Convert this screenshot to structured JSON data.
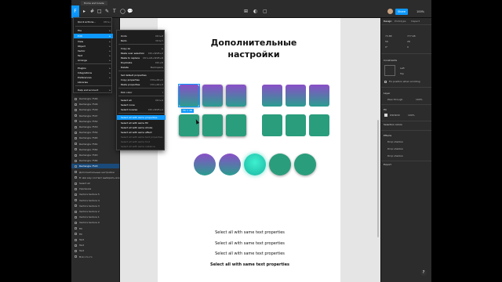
{
  "window": {
    "tab_title": "Home and Grade"
  },
  "toolbar": {
    "figma_glyph": "F",
    "tools": [
      "▸",
      "#",
      "□",
      "✎",
      "T",
      "◯",
      "💬"
    ],
    "center_tools": [
      "⊞",
      "◐",
      "▢"
    ],
    "share_label": "Share",
    "zoom_label": "100%"
  },
  "layers": [
    "Rectangle 7566",
    "Rectangle 7546",
    "Rectangle 7549",
    "Rectangle 7547",
    "Rectangle 7552",
    "Rectangle 7553",
    "Rectangle 7554",
    "Rectangle 7565",
    "Rectangle 7561",
    "Rectangle 7562",
    "Rectangle 7563",
    "Rectangle 7584",
    "Rectangle 7543",
    "Дополнительные настройки",
    "В чём ему соответ выбирать все",
    "Select all",
    "Удаление",
    "Vectors texture 5",
    "Vectors texture 4",
    "Vectors texture 3",
    "Vectors texture 2",
    "Vectors texture 1",
    "Vectors texture 0",
    "Fill",
    "Fill",
    "Text",
    "Text",
    "Text",
    "Всё что-то"
  ],
  "canvas": {
    "title": "Дополнительные настройки",
    "size_badge": "56 × 28",
    "texts": [
      "Select all with same text properties",
      "Select all with same text properties",
      "Select all with same text properties",
      "Select all with same text properties"
    ]
  },
  "main_menu": {
    "search": {
      "label": "Quick actions...",
      "shortcut": "Ctrl+/"
    },
    "items": [
      {
        "label": "File",
        "shortcut": "▸"
      },
      {
        "label": "Edit",
        "shortcut": "▸",
        "highlight": true
      },
      {
        "label": "View",
        "shortcut": "▸"
      },
      {
        "label": "Object",
        "shortcut": "▸"
      },
      {
        "label": "Vector",
        "shortcut": "▸"
      },
      {
        "label": "Text",
        "shortcut": "▸"
      },
      {
        "label": "Arrange",
        "shortcut": "▸"
      },
      {
        "label": "Plugins",
        "shortcut": "▸"
      },
      {
        "label": "Integrations",
        "shortcut": "▸"
      },
      {
        "label": "Preferences",
        "shortcut": "▸"
      },
      {
        "label": "Libraries",
        "shortcut": ""
      },
      {
        "label": "Help and account",
        "shortcut": "▸"
      }
    ]
  },
  "edit_menu": {
    "items": [
      {
        "label": "Undo",
        "shortcut": "Ctrl+Z"
      },
      {
        "label": "Redo",
        "shortcut": "Ctrl+Y"
      },
      {
        "label": "Copy as",
        "shortcut": "▸"
      },
      {
        "label": "Paste over selection",
        "shortcut": "Ctrl+Shift+V"
      },
      {
        "label": "Paste to replace",
        "shortcut": "Ctrl+Alt+Shift+R"
      },
      {
        "label": "Duplicate",
        "shortcut": "Ctrl+D"
      },
      {
        "label": "Delete",
        "shortcut": "Backspace"
      },
      {
        "label": "Set default properties",
        "shortcut": ""
      },
      {
        "label": "Copy properties",
        "shortcut": "Ctrl+Alt+C"
      },
      {
        "label": "Paste properties",
        "shortcut": "Ctrl+Alt+V"
      },
      {
        "label": "Pick color",
        "shortcut": "I"
      },
      {
        "label": "Select all",
        "shortcut": "Ctrl+A"
      },
      {
        "label": "Select none",
        "shortcut": ""
      },
      {
        "label": "Select inverse",
        "shortcut": "Ctrl+Shift+A"
      },
      {
        "label": "Select all with same properties",
        "shortcut": "",
        "highlight": true
      },
      {
        "label": "Select all with same fill",
        "shortcut": ""
      },
      {
        "label": "Select all with same stroke",
        "shortcut": ""
      },
      {
        "label": "Select all with same effect",
        "shortcut": ""
      },
      {
        "label": "Select all with same text properties",
        "shortcut": "",
        "dim": true
      },
      {
        "label": "Select all with same font",
        "shortcut": "",
        "dim": true
      },
      {
        "label": "Select all with same instance",
        "shortcut": "",
        "dim": true
      }
    ]
  },
  "right_panel": {
    "tabs": [
      "Design",
      "Prototype",
      "Inspect"
    ],
    "x": "73.88",
    "y": "777.98",
    "w": "56",
    "h": "28",
    "rotation": "0°",
    "radius": "0",
    "constraints_label": "Constraints",
    "constraint_h": "Left",
    "constraint_v": "Top",
    "fix_label": "Fix position when scrolling",
    "layer_label": "Layer",
    "pass_through": "Pass through",
    "opacity": "100%",
    "fill_label": "Fill",
    "fill_hex": "D9D9D9",
    "fill_opacity": "100%",
    "selection_colors": "Selection colors",
    "effects_label": "Effects",
    "effects": [
      "Drop shadow",
      "Drop shadow",
      "Drop shadow"
    ],
    "export_label": "Export"
  },
  "help": "?"
}
